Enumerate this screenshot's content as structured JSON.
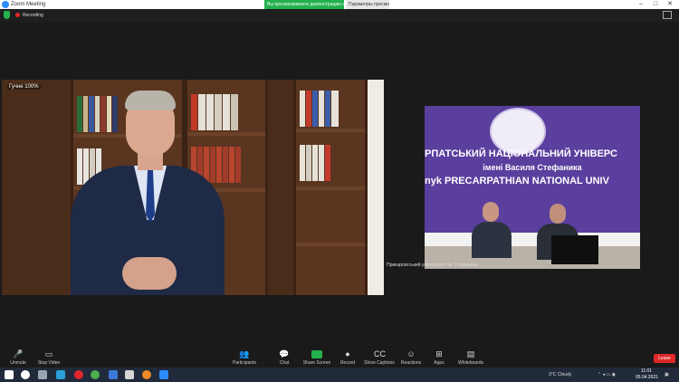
{
  "window": {
    "title": "Zoom Meeting",
    "sharing_notice": "Вы просматриваете демонстрацию экрана",
    "view_options": "Параметры просмотра",
    "minimize": "–",
    "maximize": "□",
    "close": "✕"
  },
  "infobar": {
    "recording_label": "Recording"
  },
  "tiles": {
    "main": {
      "zoom_label": "Гучне 100%"
    },
    "side": {
      "banner_line1": "РПАТСЬКИЙ НАЦІОНАЛЬНИЙ УНІВЕРС",
      "banner_line2": "імені Василя Стефаника",
      "banner_line3": "nyk PRECARPATHIAN NATIONAL UNIV",
      "participant_label": "Прикарпатський університет ім. Стефаника"
    }
  },
  "controls": [
    {
      "name": "unmute",
      "label": "Unmute",
      "icon": "🎤"
    },
    {
      "name": "stop-video",
      "label": "Stop Video",
      "icon": "▭"
    },
    {
      "name": "participants",
      "label": "Participants",
      "icon": "👥"
    },
    {
      "name": "chat",
      "label": "Chat",
      "icon": "💬"
    },
    {
      "name": "share-screen",
      "label": "Share Screen",
      "icon": ""
    },
    {
      "name": "record",
      "label": "Record",
      "icon": "●"
    },
    {
      "name": "show-captions",
      "label": "Show Captions",
      "icon": "CC"
    },
    {
      "name": "reactions",
      "label": "Reactions",
      "icon": "☺"
    },
    {
      "name": "apps",
      "label": "Apps",
      "icon": "⊞"
    },
    {
      "name": "whiteboards",
      "label": "Whiteboards",
      "icon": "▤"
    }
  ],
  "leave_label": "Leave",
  "taskbar": {
    "weather": "3°C Cloudy",
    "time": "11:01",
    "date": "05.04.2021",
    "colors": {
      "start": "#ffffff",
      "search": "#ffffff",
      "edge": "#2a9fd6",
      "chrome": "#4caf50",
      "opera": "#e0262b",
      "store": "#3b7ad9",
      "photos": "#d6d6d6",
      "firefox": "#f08a24",
      "zoom": "#2d8cff"
    }
  },
  "colors": {
    "sharing_green": "#23b14d",
    "leave_red": "#e02828",
    "banner_purple": "#5a3f9e"
  }
}
